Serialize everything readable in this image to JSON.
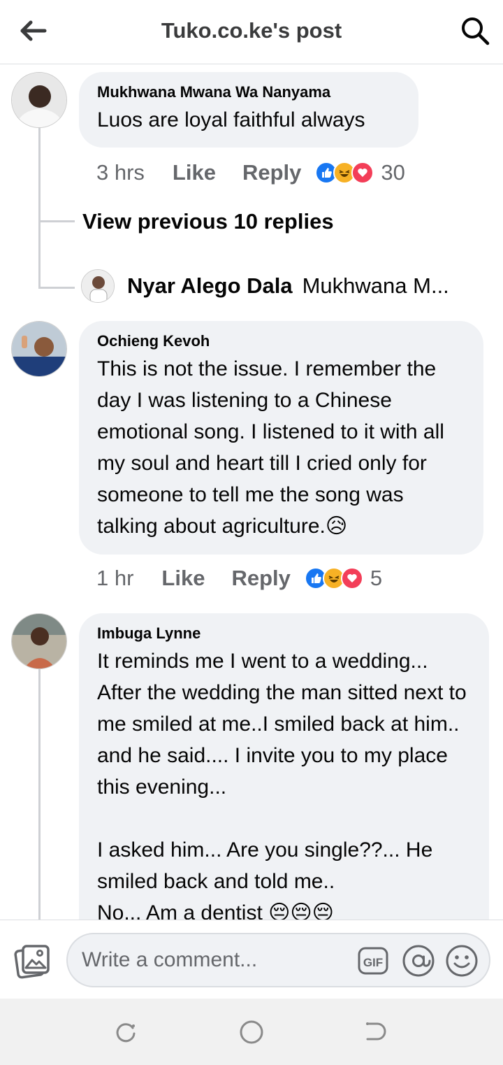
{
  "header": {
    "title": "Tuko.co.ke's post",
    "back_icon": "arrow-left-icon",
    "search_icon": "search-icon"
  },
  "comments": [
    {
      "author": "Mukhwana Mwana Wa Nanyama",
      "text": "Luos are loyal faithful always",
      "time": "3 hrs",
      "like_label": "Like",
      "reply_label": "Reply",
      "reaction_count": "30",
      "reactions": [
        "like-reaction-icon",
        "haha-reaction-icon",
        "love-reaction-icon"
      ]
    },
    {
      "author": "Ochieng Kevoh",
      "text": "This is not the issue. I remember the day I was listening to a Chinese emotional song. I listened to it with all my soul and heart till I cried only for someone to tell me the song was talking about agriculture.😥",
      "time": "1 hr",
      "like_label": "Like",
      "reply_label": "Reply",
      "reaction_count": "5",
      "reactions": [
        "like-reaction-icon",
        "haha-reaction-icon",
        "love-reaction-icon"
      ]
    },
    {
      "author": "Imbuga Lynne",
      "text": "It reminds me I went to a wedding... After the wedding the man sitted next to me smiled at me..I smiled back at him.. and he said.... I invite you to my place this evening...\n\nI asked him... Are you single??... He smiled back and told me..\nNo... Am a dentist 😔😔😔"
    }
  ],
  "view_previous_replies": "View previous 10 replies",
  "reply_preview": {
    "name": "Nyar Alego Dala",
    "snippet": "Mukhwana M..."
  },
  "composer": {
    "placeholder": "Write a comment...",
    "photo_icon": "photo-icon",
    "gif_label": "GIF",
    "mention_icon": "at-sign-icon",
    "emoji_icon": "smiley-icon"
  },
  "navbar": {
    "recents_icon": "recents-icon",
    "home_icon": "home-circle-icon",
    "back_icon": "back-gesture-icon"
  },
  "colors": {
    "bubble": "#f0f2f5",
    "meta": "#65676b",
    "like": "#1877f2",
    "haha": "#f7b125",
    "love": "#f33e58"
  }
}
